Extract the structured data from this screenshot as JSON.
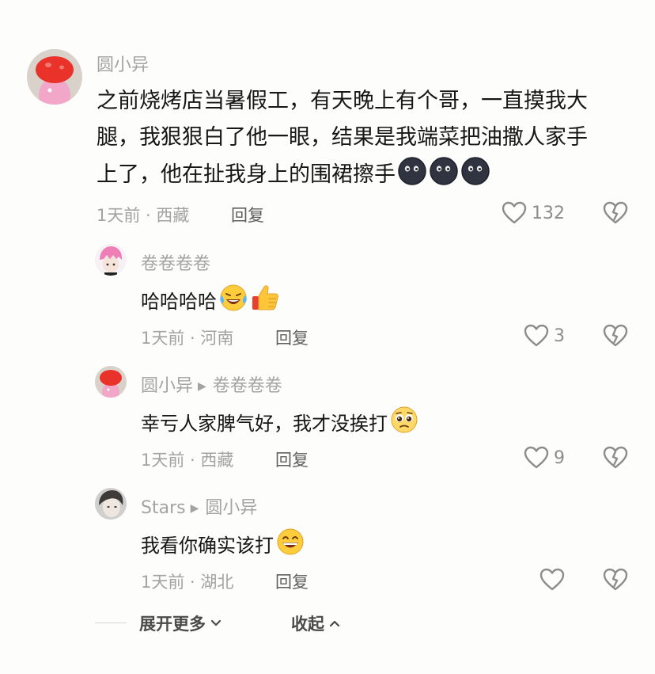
{
  "comment": {
    "username": "圆小异",
    "text_lines": [
      "之前烧烤店当暑假工，有天晚上有个哥，一直摸我大",
      "腿，我狠狠白了他一眼，结果是我端菜把油撒人家手",
      "上了，他在扯我身上的围裙擦手"
    ],
    "emojis": [
      "black-moon-face-emoji",
      "black-moon-face-emoji",
      "black-moon-face-emoji"
    ],
    "meta": "1天前 · 西藏",
    "reply_label": "回复",
    "like_count": "132"
  },
  "replies": [
    {
      "username": "卷卷卷卷",
      "reply_to": "",
      "text": "哈哈哈哈",
      "emojis": [
        "laughing-tears-emoji",
        "thumbs-up-emoji"
      ],
      "meta": "1天前 · 河南",
      "reply_label": "回复",
      "like_count": "3"
    },
    {
      "username": "圆小异",
      "reply_to": "卷卷卷卷",
      "text": "幸亏人家脾气好，我才没挨打",
      "emojis": [
        "pleading-face-emoji"
      ],
      "meta": "1天前 · 西藏",
      "reply_label": "回复",
      "like_count": "9"
    },
    {
      "username": "Stars",
      "reply_to": "圆小异",
      "text": "我看你确实该打",
      "emojis": [
        "grinning-sweat-emoji"
      ],
      "meta": "1天前 · 湖北",
      "reply_label": "回复",
      "like_count": ""
    }
  ],
  "footer": {
    "expand_label": "展开更多",
    "collapse_label": "收起"
  },
  "colors": {
    "background": "#fdfdfb",
    "text": "#161616",
    "muted": "#a3a3a3"
  }
}
